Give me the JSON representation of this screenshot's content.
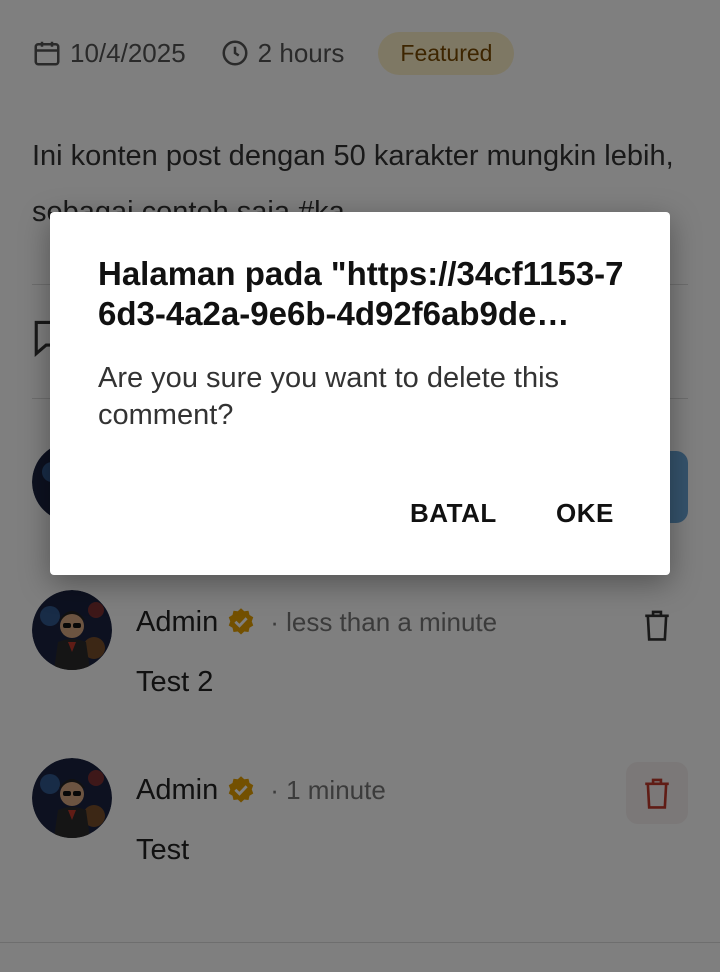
{
  "post": {
    "date": "10/4/2025",
    "duration": "2 hours",
    "badge": "Featured",
    "content": "Ini konten post dengan 50 karakter mungkin lebih, sebagai contoh saja #ka"
  },
  "comments": [
    {
      "name": "Admin",
      "time": "· less than a minute",
      "text": "Test 2"
    },
    {
      "name": "Admin",
      "time": "· 1 minute",
      "text": "Test"
    }
  ],
  "dialog": {
    "title": "Halaman pada \"https://34cf1153-76d3-4a2a-9e6b-4d92f6ab9de…",
    "message": "Are you sure you want to delete this comment?",
    "cancel_label": "BATAL",
    "ok_label": "OKE"
  },
  "colors": {
    "badge_bg": "#fdf0c8",
    "verified": "#e6a100",
    "trash_active": "#c0392b",
    "send_button": "#6aa6d8"
  },
  "icons": {
    "date": "calendar-icon",
    "duration": "clock-icon",
    "comment": "comment-bubble-icon",
    "verified": "verified-badge-icon",
    "delete": "trash-icon"
  }
}
